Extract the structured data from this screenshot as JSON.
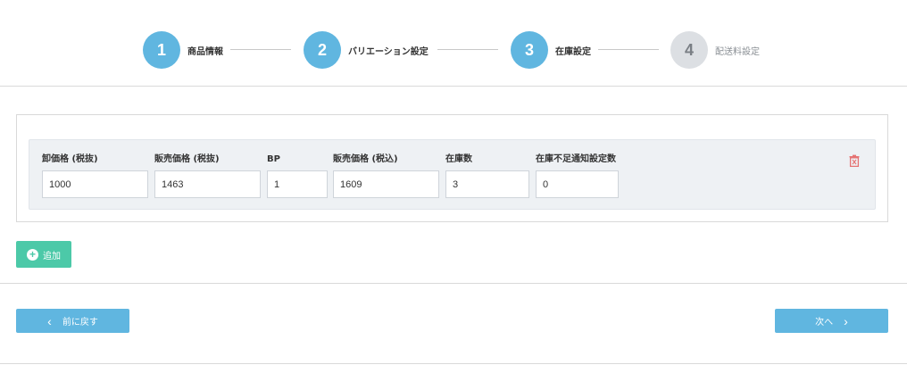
{
  "stepper": {
    "steps": [
      {
        "number": "1",
        "label": "商品情報",
        "active": true
      },
      {
        "number": "2",
        "label": "バリエーション設定",
        "active": true
      },
      {
        "number": "3",
        "label": "在庫設定",
        "active": true
      },
      {
        "number": "4",
        "label": "配送料設定",
        "active": false
      }
    ]
  },
  "variation": {
    "fields": [
      {
        "label": "卸価格 (税抜)",
        "value": "1000"
      },
      {
        "label": "販売価格 (税抜)",
        "value": "1463"
      },
      {
        "label": "BP",
        "value": "1"
      },
      {
        "label": "販売価格 (税込)",
        "value": "1609"
      },
      {
        "label": "在庫数",
        "value": "3"
      },
      {
        "label": "在庫不足通知設定数",
        "value": "0"
      }
    ],
    "delete_icon": "trash-icon"
  },
  "add_button": {
    "label": "追加",
    "icon": "plus-circle-icon"
  },
  "navigation": {
    "prev_label": "前に戻す",
    "next_label": "次へ"
  },
  "colors": {
    "step_active": "#60b6e0",
    "step_inactive": "#dcdfe3",
    "add_button": "#4cc9a8",
    "nav_button": "#60b6e0",
    "delete_icon": "#e57373"
  }
}
